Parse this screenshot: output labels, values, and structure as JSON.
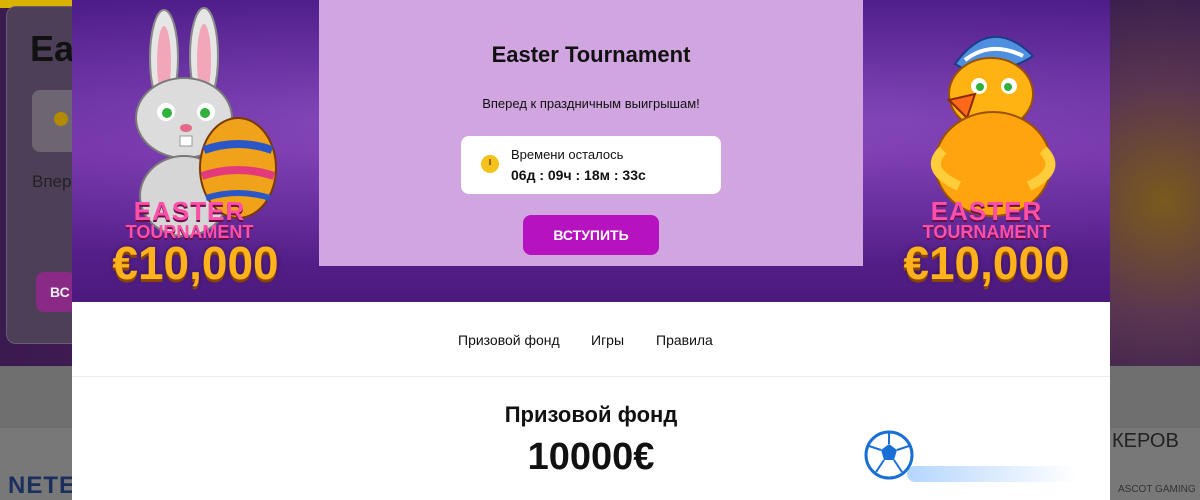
{
  "background": {
    "title_fragment": "Ea",
    "subtitle_fragment": "Впер",
    "join_fragment": "ВС",
    "right_text_fragment": "КЕРОВ",
    "right_sub_fragment": "ASCOT GAMING",
    "left_brand_fragment": "NETE"
  },
  "banner": {
    "title": "Easter Tournament",
    "subtitle": "Вперед к праздничным выигрышам!",
    "timer_label": "Времени осталось",
    "timer_value": "06д : 09ч : 18м : 33с",
    "join_label": "ВСТУПИТЬ",
    "promo": {
      "line1": "EASTER",
      "line2": "TOURNAMENT",
      "amount": "€10,000"
    }
  },
  "tabs": [
    "Призовой фонд",
    "Игры",
    "Правила"
  ],
  "prize": {
    "title": "Призовой фонд",
    "amount": "10000€"
  },
  "colors": {
    "accent": "#b712bf",
    "banner_panel": "#d1a5e0",
    "timer_icon": "#f4c21a"
  },
  "icons": [
    "clock-icon",
    "bunny-illustration",
    "chick-illustration",
    "football-icon"
  ]
}
